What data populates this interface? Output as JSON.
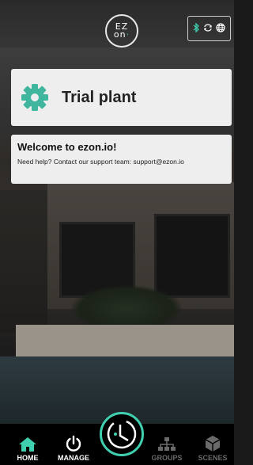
{
  "app": {
    "logo_text_top": "EZ",
    "logo_text_bottom": "on",
    "accent": "#3fd0b0"
  },
  "status": {
    "icons": [
      "bluetooth-icon",
      "sync-icon",
      "globe-icon"
    ]
  },
  "plant": {
    "name": "Trial plant",
    "icon": "gear-icon"
  },
  "welcome": {
    "title": "Welcome to ezon.io!",
    "text": "Need help? Contact our support team: support@ezon.io"
  },
  "nav": {
    "home": "HOME",
    "manage": "MANAGE",
    "groups": "GROUPS",
    "scenes": "SCENES"
  }
}
